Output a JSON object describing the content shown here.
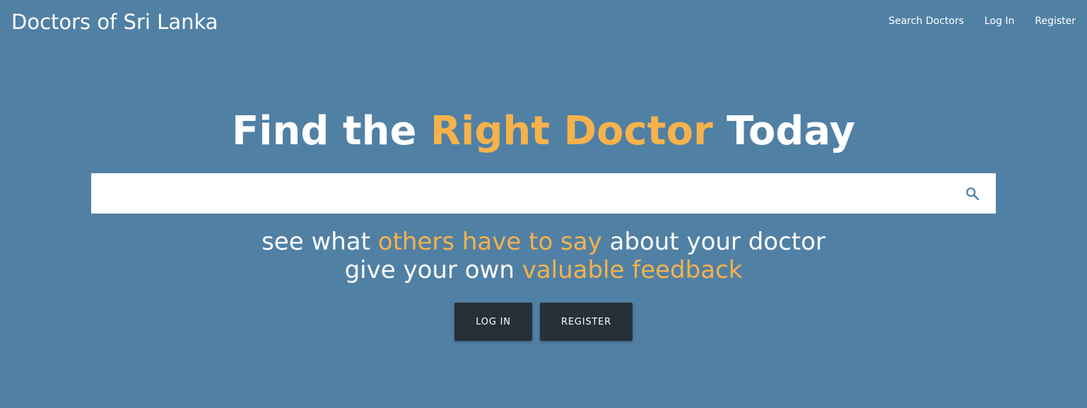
{
  "navbar": {
    "brand": "Doctors of Sri Lanka",
    "links": [
      {
        "label": "Search Doctors"
      },
      {
        "label": "Log In"
      },
      {
        "label": "Register"
      }
    ]
  },
  "hero": {
    "title_prefix": "Find the ",
    "title_highlight": "Right Doctor",
    "title_suffix": " Today"
  },
  "search": {
    "value": "",
    "placeholder": "",
    "icon": "search-icon"
  },
  "tagline": {
    "line1_prefix": "see what ",
    "line1_highlight": "others have to say",
    "line1_suffix": " about your doctor",
    "line2_prefix": "give your own ",
    "line2_highlight": "valuable feedback"
  },
  "buttons": {
    "login_label": "LOG IN",
    "register_label": "REGISTER"
  },
  "colors": {
    "background": "#5180a5",
    "accent": "#f6b24b",
    "button": "#263039",
    "text": "#ffffff"
  }
}
